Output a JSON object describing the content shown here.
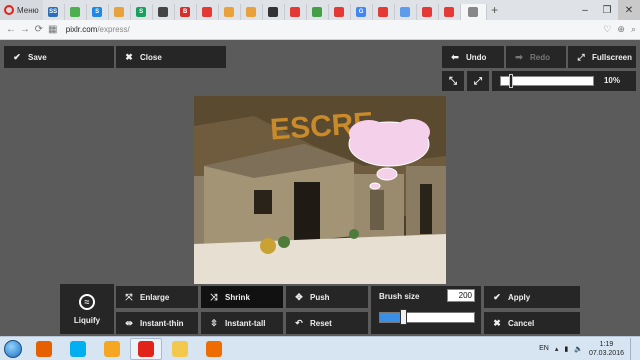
{
  "browser": {
    "menu_label": "Меню",
    "tabs": [
      {
        "icon": "ss-favicon",
        "label": "SS",
        "color": "#2d6fb8"
      },
      {
        "icon": "chrome-favicon",
        "label": "",
        "color": "#4caf50"
      },
      {
        "icon": "s-favicon",
        "label": "S",
        "color": "#1e88e5"
      },
      {
        "icon": "cart-favicon",
        "label": "",
        "color": "#e9a13b"
      },
      {
        "icon": "s-green-favicon",
        "label": "S",
        "color": "#18a05e"
      },
      {
        "icon": "bird-favicon",
        "label": "",
        "color": "#444444"
      },
      {
        "icon": "b-favicon",
        "label": "B",
        "color": "#d32f2f"
      },
      {
        "icon": "youtube-favicon",
        "label": "",
        "color": "#e53935"
      },
      {
        "icon": "cart-favicon",
        "label": "",
        "color": "#e9a13b"
      },
      {
        "icon": "cart-favicon",
        "label": "",
        "color": "#e9a13b"
      },
      {
        "icon": "dice-favicon",
        "label": "",
        "color": "#333333"
      },
      {
        "icon": "youtube-favicon",
        "label": "",
        "color": "#e53935"
      },
      {
        "icon": "image-favicon",
        "label": "",
        "color": "#43a047"
      },
      {
        "icon": "youtube-favicon",
        "label": "",
        "color": "#e53935"
      },
      {
        "icon": "google-favicon",
        "label": "G",
        "color": "#4285f4"
      },
      {
        "icon": "youtube-favicon",
        "label": "",
        "color": "#e53935"
      },
      {
        "icon": "image-favicon",
        "label": "",
        "color": "#5d9cec"
      },
      {
        "icon": "youtube-favicon",
        "label": "",
        "color": "#e53935"
      },
      {
        "icon": "youtube-favicon",
        "label": "",
        "color": "#e53935"
      },
      {
        "icon": "page-favicon",
        "label": "",
        "color": "#888888",
        "active": true
      }
    ],
    "url_host": "pixlr.com",
    "url_path": "/express/"
  },
  "toolbar": {
    "save_label": "Save",
    "close_label": "Close",
    "undo_label": "Undo",
    "redo_label": "Redo",
    "fullscreen_label": "Fullscreen",
    "zoom_percent": 10,
    "zoom_label": "10%"
  },
  "liquify": {
    "tool_label": "Liquify",
    "buttons": {
      "enlarge": "Enlarge",
      "shrink": "Shrink",
      "push": "Push",
      "instant_thin": "Instant-thin",
      "instant_tall": "Instant-tall",
      "reset": "Reset"
    },
    "brush_size_label": "Brush size",
    "brush_size_value": "200",
    "brush_size_fraction": 0.26,
    "apply_label": "Apply",
    "cancel_label": "Cancel"
  },
  "taskbar": {
    "apps": [
      {
        "icon": "firefox-icon",
        "color": "#e66000"
      },
      {
        "icon": "skype-icon",
        "color": "#00aff0"
      },
      {
        "icon": "headphones-icon",
        "color": "#f5a623"
      },
      {
        "icon": "opera-icon",
        "color": "#e2231a",
        "active": true
      },
      {
        "icon": "folder-icon",
        "color": "#f2c94c"
      },
      {
        "icon": "media-icon",
        "color": "#ef6c00"
      }
    ],
    "language": "EN",
    "time": "1:19",
    "date": "07.03.2016"
  }
}
